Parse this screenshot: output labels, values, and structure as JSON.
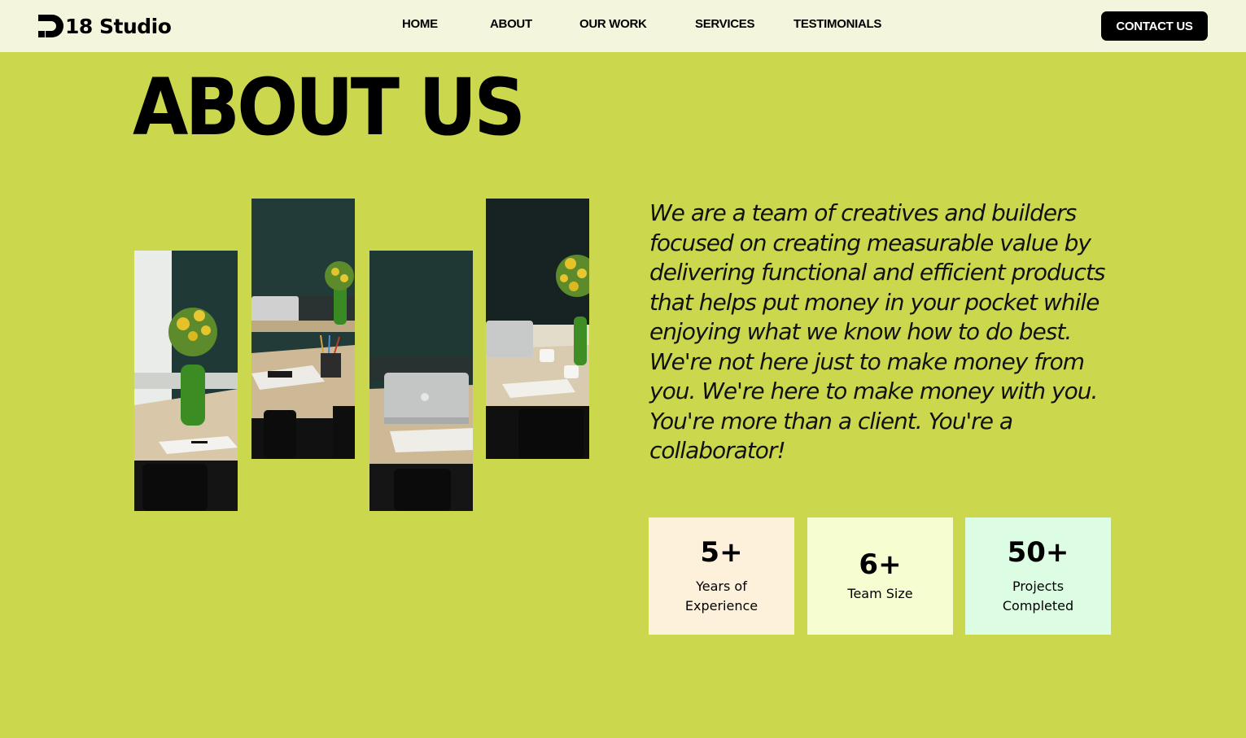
{
  "brand": {
    "name": "18 Studio"
  },
  "nav": {
    "items": [
      {
        "label": "HOME"
      },
      {
        "label": "ABOUT"
      },
      {
        "label": "OUR WORK"
      },
      {
        "label": "SERVICES"
      },
      {
        "label": "TESTIMONIALS"
      }
    ],
    "contact_label": "CONTACT US"
  },
  "about": {
    "title": "ABOUT US",
    "text": "We are a team of creatives and builders focused on creating measurable value by delivering functional and efficient products that helps put money in your pocket while enjoying what we know how to do best. We're not here just to make money from you. We're here to make money with you. You're more than a client. You're a collaborator!"
  },
  "stats": [
    {
      "value": "5+",
      "label_lines": [
        "Years of",
        "Experience"
      ],
      "color": "#fdf1dc"
    },
    {
      "value": "6+",
      "label_lines": [
        "Team Size"
      ],
      "color": "#f6fdd0"
    },
    {
      "value": "50+",
      "label_lines": [
        "Projects",
        "Completed"
      ],
      "color": "#dcfde3"
    }
  ],
  "colors": {
    "background": "#cbd84e",
    "header": "#f3f6dc",
    "button": "#000000"
  }
}
